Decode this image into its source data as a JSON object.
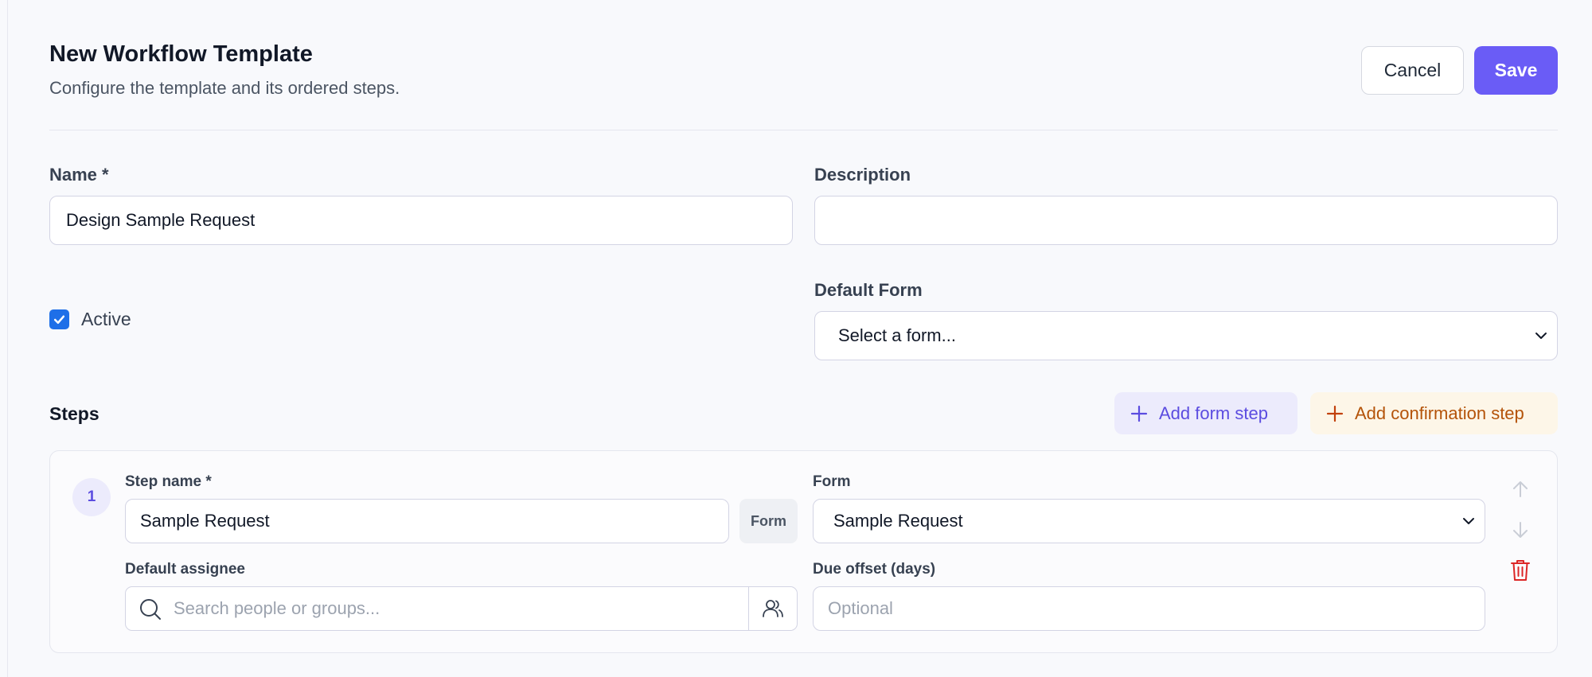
{
  "header": {
    "title": "New Workflow Template",
    "subtitle": "Configure the template and its ordered steps.",
    "cancel_label": "Cancel",
    "save_label": "Save"
  },
  "form": {
    "name_label": "Name *",
    "name_value": "Design Sample Request",
    "description_label": "Description",
    "description_value": "",
    "active_label": "Active",
    "active_checked": true,
    "default_form_label": "Default Form",
    "default_form_value": "Select a form..."
  },
  "steps": {
    "heading": "Steps",
    "add_form_step_label": "Add form step",
    "add_confirmation_step_label": "Add confirmation step",
    "items": [
      {
        "number": "1",
        "step_name_label": "Step name *",
        "step_name_value": "Sample Request",
        "type_badge": "Form",
        "form_label": "Form",
        "form_value": "Sample Request",
        "assignee_label": "Default assignee",
        "assignee_placeholder": "Search people or groups...",
        "due_offset_label": "Due offset (days)",
        "due_offset_placeholder": "Optional"
      }
    ]
  },
  "colors": {
    "accent": "#6a5cf6",
    "checkbox": "#1e6fe8",
    "confirm_accent": "#b45309",
    "danger": "#dc2626"
  },
  "icons": [
    "check-icon",
    "chevron-down-icon",
    "plus-icon",
    "search-icon",
    "people-icon",
    "arrow-up-icon",
    "arrow-down-icon",
    "trash-icon"
  ]
}
